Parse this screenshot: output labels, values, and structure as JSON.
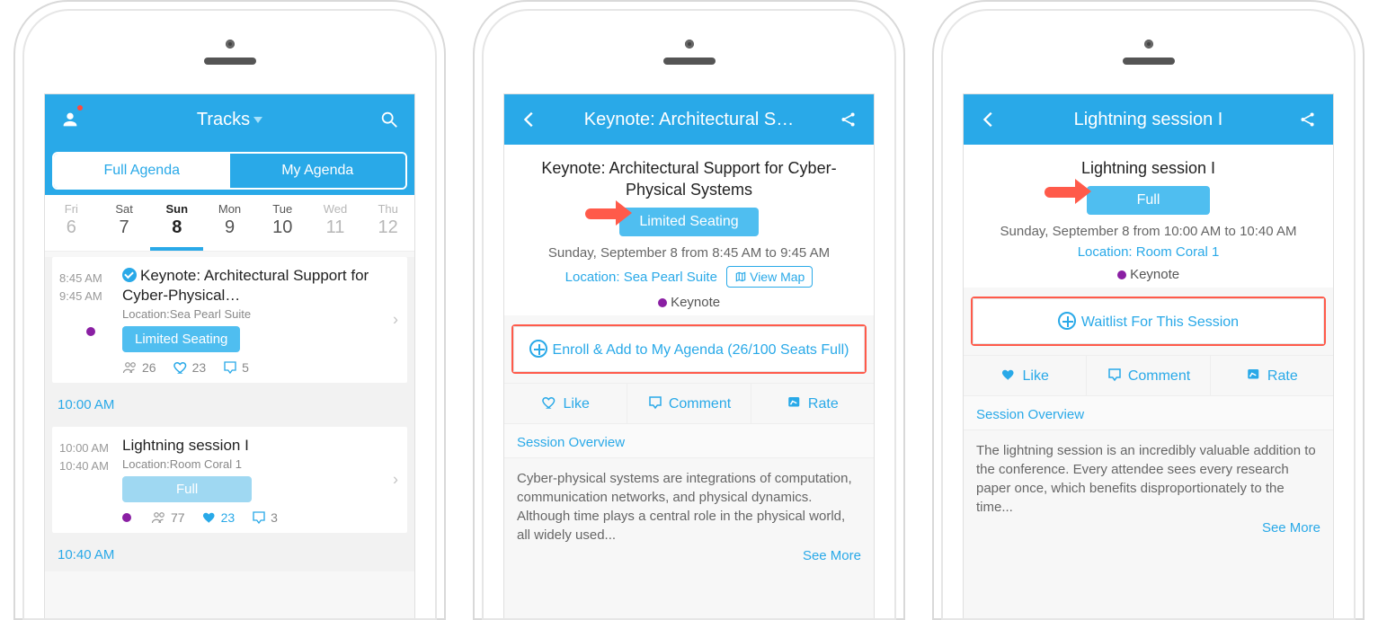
{
  "screen1": {
    "header": {
      "title": "Tracks"
    },
    "segments": {
      "full": "Full Agenda",
      "mine": "My Agenda"
    },
    "days": [
      {
        "name": "Fri",
        "num": "6",
        "dark": false,
        "active": false
      },
      {
        "name": "Sat",
        "num": "7",
        "dark": true,
        "active": false
      },
      {
        "name": "Sun",
        "num": "8",
        "dark": true,
        "active": true
      },
      {
        "name": "Mon",
        "num": "9",
        "dark": true,
        "active": false
      },
      {
        "name": "Tue",
        "num": "10",
        "dark": true,
        "active": false
      },
      {
        "name": "Wed",
        "num": "11",
        "dark": false,
        "active": false
      },
      {
        "name": "Thu",
        "num": "12",
        "dark": false,
        "active": false
      }
    ],
    "session1": {
      "start": "8:45 AM",
      "end": "9:45 AM",
      "title": "Keynote: Architectural Support for Cyber-Physical…",
      "location": "Location:Sea Pearl Suite",
      "status": "Limited Seating",
      "attend": "26",
      "likes": "23",
      "comments": "5"
    },
    "sep1": "10:00 AM",
    "session2": {
      "start": "10:00 AM",
      "end": "10:40 AM",
      "title": "Lightning session I",
      "location": "Location:Room Coral 1",
      "status": "Full",
      "attend": "77",
      "likes": "23",
      "comments": "3"
    },
    "sep2": "10:40 AM"
  },
  "screen2": {
    "header_title": "Keynote: Architectural S…",
    "title": "Keynote: Architectural Support for Cyber-Physical Systems",
    "status": "Limited Seating",
    "datetime": "Sunday, September 8 from 8:45 AM to 9:45 AM",
    "location": "Location: Sea Pearl Suite",
    "viewmap": "View Map",
    "track": "Keynote",
    "enroll": "Enroll & Add to My Agenda (26/100 Seats Full)",
    "like": "Like",
    "comment": "Comment",
    "rate": "Rate",
    "section": "Session Overview",
    "overview": "Cyber-physical systems are integrations of computation, communication networks, and physical dynamics. Although time plays a central role in the physical world, all widely used...",
    "see_more": "See More"
  },
  "screen3": {
    "header_title": "Lightning session I",
    "title": "Lightning session I",
    "status": "Full",
    "datetime": "Sunday, September 8 from 10:00 AM to 10:40 AM",
    "location": "Location: Room Coral 1",
    "track": "Keynote",
    "enroll": "Waitlist For This Session",
    "like": "Like",
    "comment": "Comment",
    "rate": "Rate",
    "section": "Session Overview",
    "overview": "The lightning session is an incredibly valuable addition to the conference. Every attendee sees every research paper once, which benefits disproportionately to the time...",
    "see_more": "See More"
  }
}
